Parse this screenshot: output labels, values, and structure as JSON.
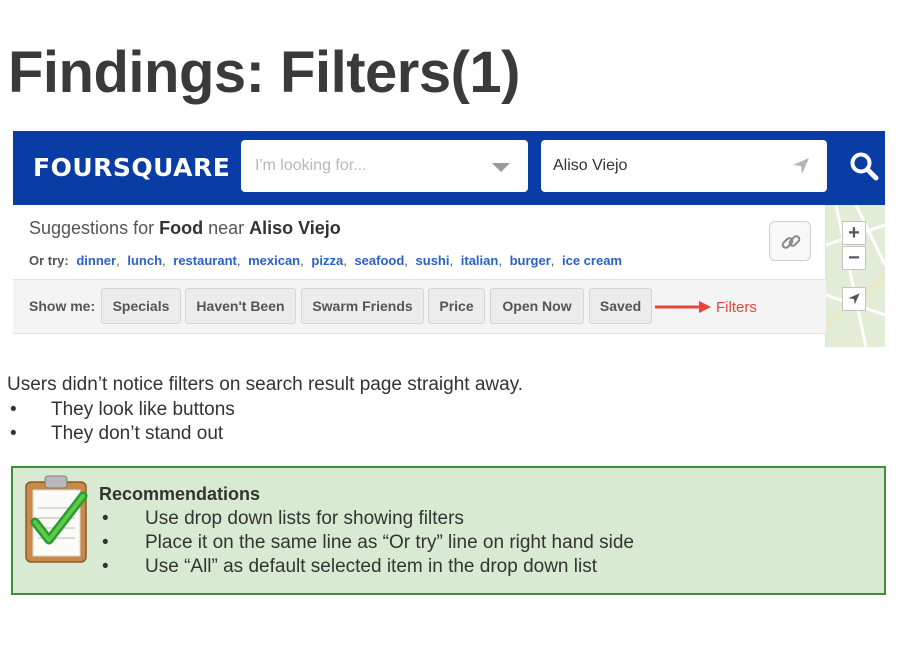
{
  "slide": {
    "title": "Findings: Filters(1)"
  },
  "foursquare": {
    "logo": "FOURSQUARE",
    "search_placeholder": "I'm looking for...",
    "near_value": "Aliso Viejo",
    "suggestions": {
      "prefix": "Suggestions for ",
      "category": "Food",
      "near_word": " near ",
      "location": "Aliso Viejo"
    },
    "or_try": {
      "label": "Or try:",
      "links": [
        "dinner",
        "lunch",
        "restaurant",
        "mexican",
        "pizza",
        "seafood",
        "sushi",
        "italian",
        "burger",
        "ice cream"
      ]
    },
    "show_me_label": "Show me:",
    "filters": [
      "Specials",
      "Haven't Been",
      "Swarm Friends",
      "Price",
      "Open Now",
      "Saved"
    ],
    "annotation": "Filters",
    "map": {
      "zoom_in": "+",
      "zoom_out": "−"
    },
    "colors": {
      "brand_blue": "#0a3ca5",
      "link_blue": "#2861c8",
      "annotation_red": "#e8453c"
    }
  },
  "finding": {
    "text": "Users didn’t notice filters on search result page straight away.",
    "bullets": [
      "They look like buttons",
      "They don’t stand out"
    ]
  },
  "recommendations": {
    "title": "Recommendations",
    "items": [
      "Use drop down lists for showing filters",
      "Place it on the same line as “Or try” line on right hand side",
      "Use “All” as default selected item in the drop down list"
    ],
    "colors": {
      "background": "#d9ead2",
      "border": "#3f8f3a"
    }
  },
  "bullet_symbol": "•"
}
